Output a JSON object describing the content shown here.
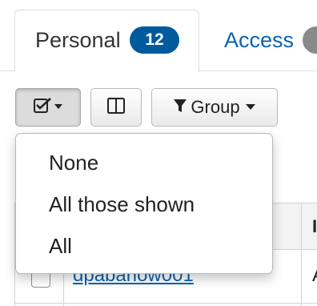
{
  "tabs": [
    {
      "label": "Personal",
      "badge": "12",
      "active": true
    },
    {
      "label": "Access",
      "active": false
    }
  ],
  "toolbar": {
    "select_icon": "checkbox-check-icon",
    "columns_icon": "columns-icon",
    "group_icon": "filter-icon",
    "group_label": "Group"
  },
  "select_menu": {
    "items": [
      "None",
      "All those shown",
      "All"
    ]
  },
  "table": {
    "rows": [
      {
        "name": "dpabarlow001",
        "next_column_fragment": "A"
      }
    ],
    "header_next_column_fragment": "I"
  },
  "colors": {
    "link": "#0d63ad",
    "badge": "#005a9c",
    "border": "#dddddd"
  }
}
